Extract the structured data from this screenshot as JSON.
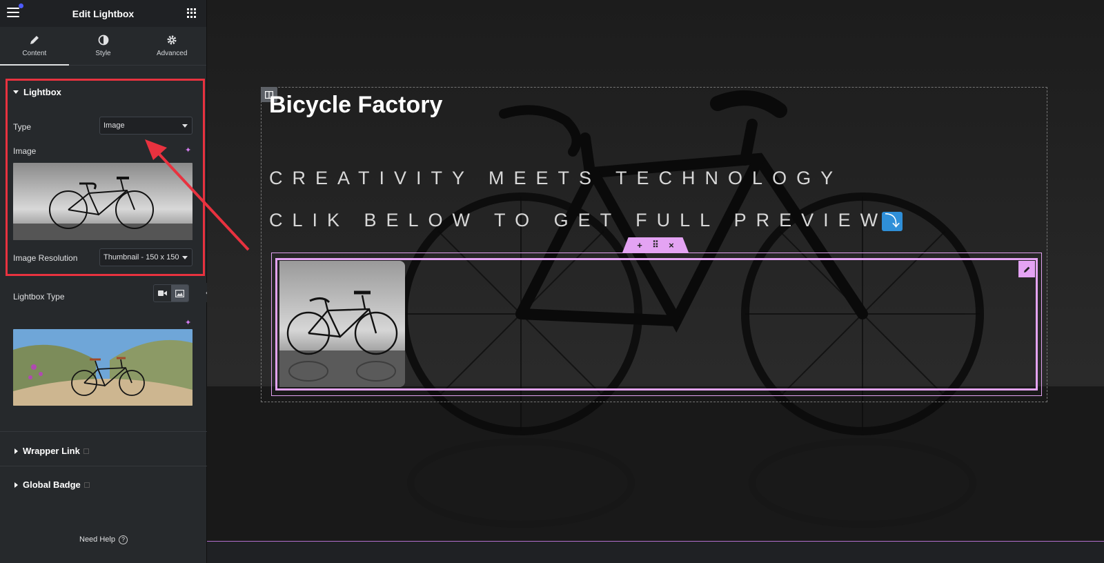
{
  "panel": {
    "title": "Edit Lightbox",
    "tabs": [
      {
        "label": "Content",
        "icon": "pencil-icon",
        "active": true
      },
      {
        "label": "Style",
        "icon": "half-circle-icon",
        "active": false
      },
      {
        "label": "Advanced",
        "icon": "gear-icon",
        "active": false
      }
    ],
    "lightbox": {
      "heading": "Lightbox",
      "type_label": "Type",
      "type_value": "Image",
      "image_label": "Image",
      "resolution_label": "Image Resolution",
      "resolution_value": "Thumbnail - 150 x 150"
    },
    "lightbox_type_label": "Lightbox Type",
    "wrapper_link": "Wrapper Link",
    "global_badge": "Global Badge",
    "need_help": "Need Help",
    "help_glyph": "?"
  },
  "canvas": {
    "site_title": "Bicycle Factory",
    "tagline_1": "CREATIVITY MEETS TECHNOLOGY",
    "tagline_2": "CLIK BELOW TO GET FULL PREVIEW",
    "arrow_glyph": "⤵",
    "toolbar": {
      "add": "+",
      "move": "⠿",
      "close": "×"
    }
  },
  "colors": {
    "annotation": "#e8323f",
    "widget_outline": "#e4a3f3",
    "panel_bg": "#26292c",
    "accent_dot": "#4d5bff"
  }
}
